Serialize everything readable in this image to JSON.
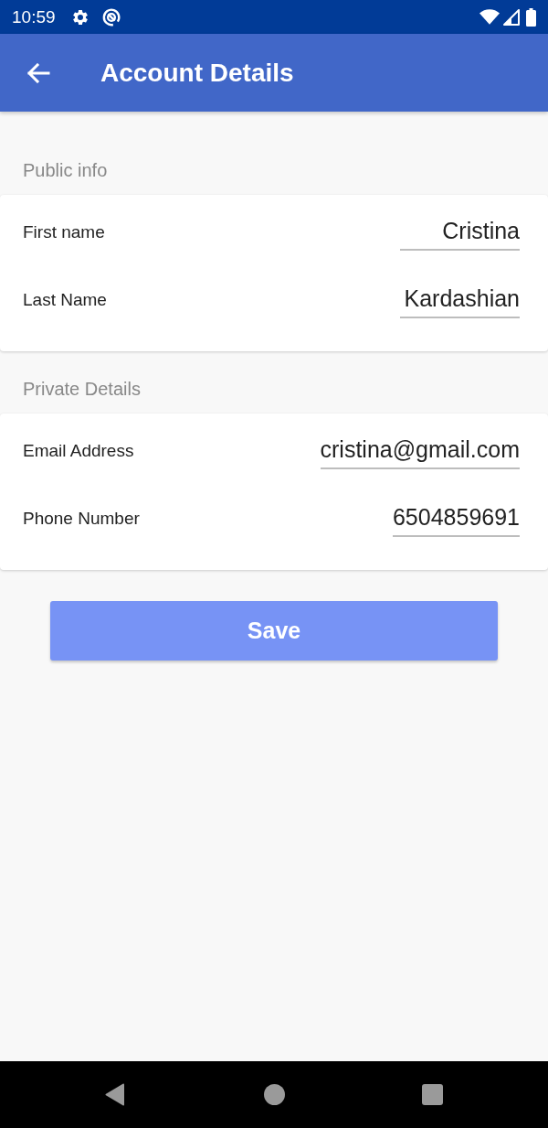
{
  "status_bar": {
    "time": "10:59"
  },
  "app_bar": {
    "title": "Account Details"
  },
  "sections": [
    {
      "header": "Public info",
      "fields": [
        {
          "label": "First name",
          "value": "Cristina"
        },
        {
          "label": "Last Name",
          "value": "Kardashian"
        }
      ]
    },
    {
      "header": "Private Details",
      "fields": [
        {
          "label": "Email Address",
          "value": "cristina@gmail.com"
        },
        {
          "label": "Phone Number",
          "value": "6504859691"
        }
      ]
    }
  ],
  "save_button": {
    "label": "Save"
  }
}
